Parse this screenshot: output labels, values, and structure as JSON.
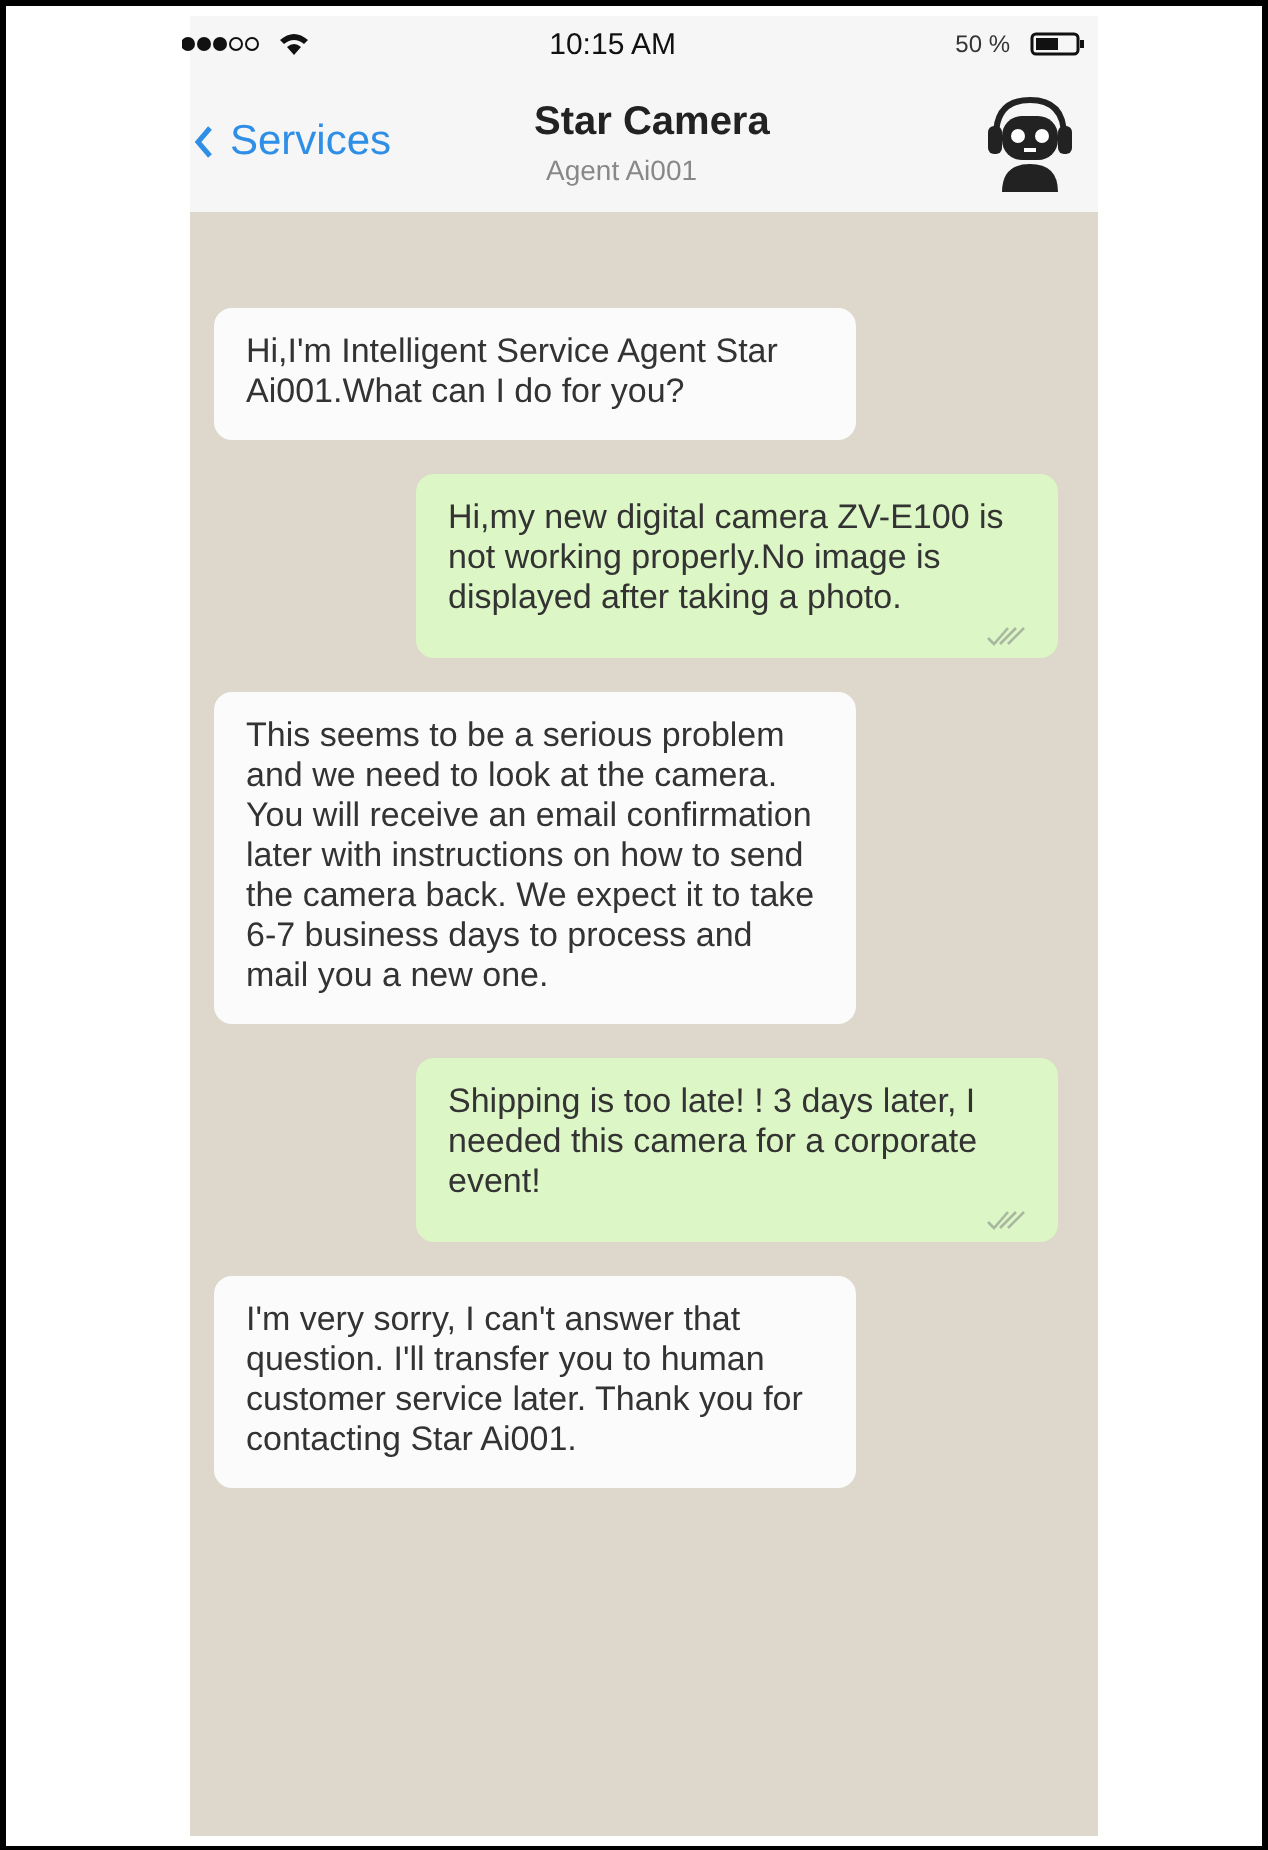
{
  "status_bar": {
    "time": "10:15 AM",
    "battery": "50 %"
  },
  "header": {
    "back": "Services",
    "title": "Star Camera",
    "subtitle": "Agent Ai001"
  },
  "messages": [
    {
      "kind": "received",
      "text": "Hi,I'm Intelligent Service Agent Star Ai001.What can I do for you?"
    },
    {
      "kind": "sent",
      "text": "Hi,my new digital camera ZV-E100 is not working properly.No image is displayed after taking a photo."
    },
    {
      "kind": "received",
      "text": "This seems to be a serious problem and we need to look at the camera. You will receive an email confirmation later with instructions on how to send the camera back. We expect it to take 6-7 business days to process and mail you a new one."
    },
    {
      "kind": "sent",
      "text": "Shipping is too late! ! 3 days later, I needed this camera for a corporate event!"
    },
    {
      "kind": "received",
      "text": "I'm very sorry, I can't answer that question. I'll transfer you to human customer service later. Thank you for contacting Star Ai001."
    }
  ]
}
